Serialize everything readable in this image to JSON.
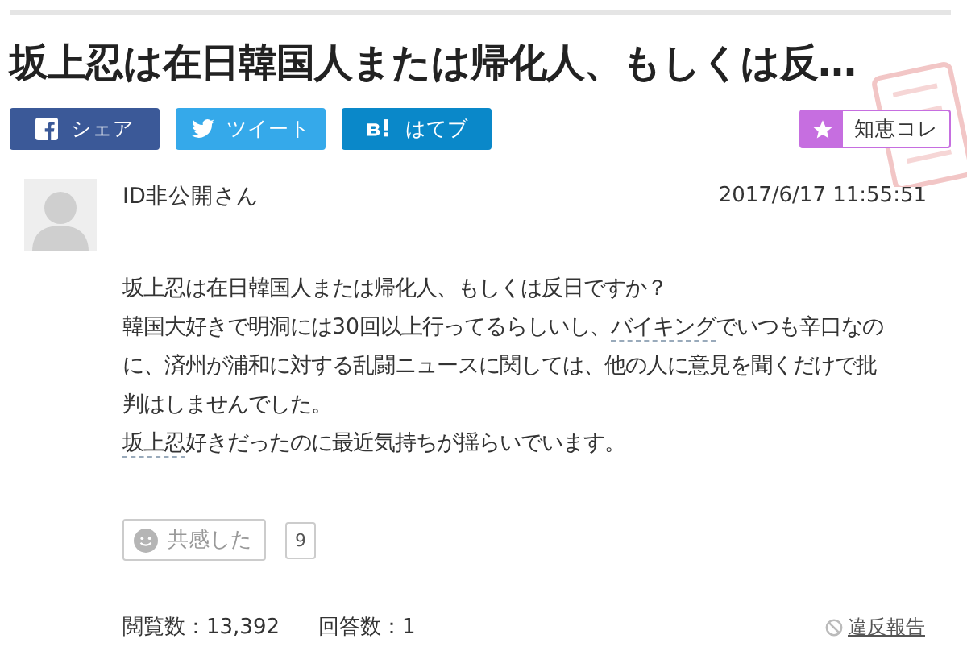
{
  "title": "坂上忍は在日韓国人または帰化人、もしくは反…",
  "share_buttons": [
    {
      "kind": "facebook",
      "label": "シェア"
    },
    {
      "kind": "twitter",
      "label": "ツイート"
    },
    {
      "kind": "hatena",
      "label": "はてブ"
    }
  ],
  "chiebukuro_button": {
    "label": "知恵コレ"
  },
  "question": {
    "author": "ID非公開さん",
    "date": "2017/6/17  11:55:51",
    "body": [
      [
        {
          "text": "坂上忍は在日韓国人または帰化人、もしくは反日ですか？",
          "link": false
        }
      ],
      [
        {
          "text": "韓国大好きで明洞には30回以上行ってるらしいし、",
          "link": false
        },
        {
          "text": "バイキング",
          "link": true
        },
        {
          "text": "でいつも辛口なのに、済州が浦和に対する乱闘ニュースに関しては、他の人に意見を聞くだけで批判はしませんでした。",
          "link": false
        }
      ],
      [
        {
          "text": "坂上忍",
          "link": true
        },
        {
          "text": "好きだったのに最近気持ちが揺らいでいます。",
          "link": false
        }
      ]
    ],
    "empathy": {
      "label": "共感した",
      "count": "9"
    },
    "views": "閲覧数：13,392",
    "answers": "回答数：1",
    "report": "違反報告"
  }
}
